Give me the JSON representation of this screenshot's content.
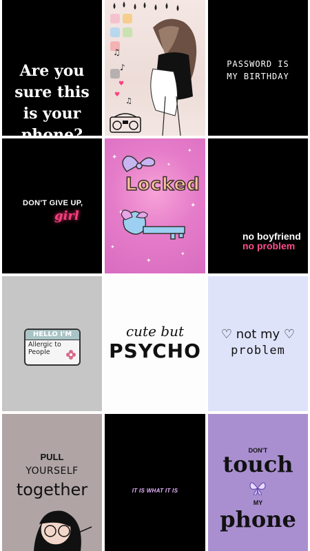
{
  "wallpapers": [
    {
      "id": "are-you-sure",
      "text": "Are you\nsure this\nis your\nphone?"
    },
    {
      "id": "girl-illustration",
      "text": ""
    },
    {
      "id": "password",
      "text": "PASSWORD IS\nMY BIRTHDAY"
    },
    {
      "id": "dont-give-up",
      "line1": "DON'T GIVE UP,",
      "line2": "girl"
    },
    {
      "id": "locked",
      "text": "Locked"
    },
    {
      "id": "no-boyfriend",
      "line1": "no boyfriend",
      "line2": "no problem"
    },
    {
      "id": "allergic",
      "badge_top": "HELLO I'M",
      "badge_text": "Allergic to\nPeople"
    },
    {
      "id": "cute-but-psycho",
      "line1": "cute but",
      "line2": "PSYCHO"
    },
    {
      "id": "not-my-problem",
      "line1": "not my",
      "line2": "problem"
    },
    {
      "id": "pull-yourself",
      "line1": "PULL",
      "line2": "YOURSELF",
      "line3": "together"
    },
    {
      "id": "it-is-what-it-is",
      "text": "IT IS WHAT IT IS"
    },
    {
      "id": "dont-touch",
      "line1": "DON'T",
      "line2": "touch",
      "line3": "MY",
      "line4": "phone"
    }
  ],
  "colors": {
    "accent_pink": "#ff4d8d",
    "locked_bg": "#e57cc9",
    "lavender": "#a98fd0"
  }
}
